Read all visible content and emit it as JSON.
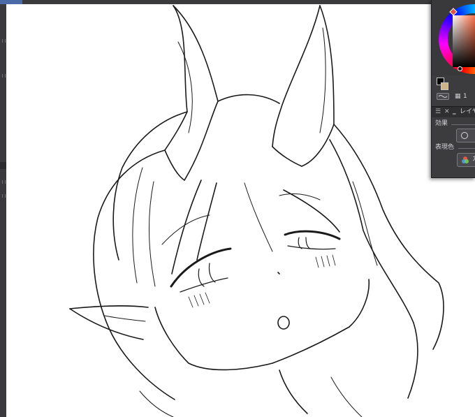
{
  "palette": {
    "panel_bg": "#3c3c3f",
    "canvas_bg": "#ffffff",
    "line_art": "#1a1a1a",
    "fg_color": "#000000",
    "bg_color": "#cdb48a"
  },
  "color_panel": {
    "selector_value": "1"
  },
  "layer_panel": {
    "title": "レイヤ",
    "effect_label": "効果",
    "expression_color_label": "表現色",
    "color_button_label": "カラ"
  },
  "icons": {
    "close": "close-icon",
    "minimize": "minimize-icon",
    "grid": "grid-icon",
    "swap": "swap-colors-icon",
    "color_wheel": "color-mode-icon"
  }
}
